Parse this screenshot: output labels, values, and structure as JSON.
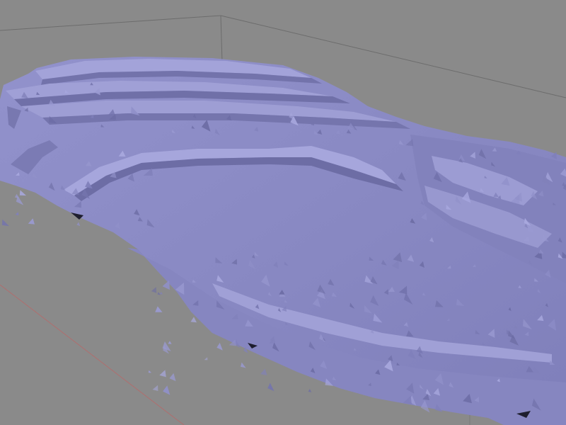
{
  "viewport": {
    "type": "3d-mesh-preview",
    "shading": "flat",
    "background_color": "#8a8a8a",
    "mesh_color": "#8d8dc6",
    "mesh_shadow_color": "#5e5e93",
    "mesh_highlight_color": "#b4b4e8",
    "grid_line_color": "#6c6c6c",
    "x_axis_color": "#b06e6e",
    "mesh_subject": "terrain-height-map",
    "toolbar": [],
    "status": []
  }
}
